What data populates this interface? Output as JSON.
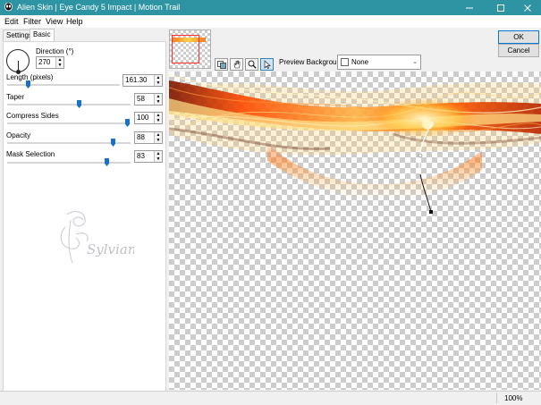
{
  "window": {
    "title": "Alien Skin | Eye Candy 5 Impact | Motion Trail",
    "controls": [
      "minimize-icon",
      "maximize-icon",
      "close-icon"
    ]
  },
  "menu": {
    "edit": "Edit",
    "filter": "Filter",
    "view": "View",
    "help": "Help"
  },
  "tabs": {
    "settings": "Settings",
    "basic": "Basic",
    "active": "Basic"
  },
  "basic": {
    "direction": {
      "label": "Direction (°)",
      "value": "270"
    },
    "length": {
      "label": "Length (pixels)",
      "value": "161.30",
      "slider": 0.18
    },
    "taper": {
      "label": "Taper",
      "value": "58",
      "slider": 0.58
    },
    "compress": {
      "label": "Compress Sides",
      "value": "100",
      "slider": 1.0
    },
    "opacity": {
      "label": "Opacity",
      "value": "88",
      "slider": 0.88
    },
    "mask": {
      "label": "Mask Selection",
      "value": "83",
      "slider": 0.83
    }
  },
  "watermark": {
    "text": "Sylviane"
  },
  "toolbar": {
    "tools": [
      "preview-toggle-icon",
      "hand-icon",
      "zoom-icon",
      "arrow-icon"
    ],
    "active_tool": "arrow-icon"
  },
  "preview_background": {
    "label": "Preview Background:",
    "value": "None"
  },
  "buttons": {
    "ok": "OK",
    "cancel": "Cancel"
  },
  "status": {
    "zoom": "100%"
  },
  "colors": {
    "titlebar": "#2e94a4",
    "accent": "#1872c8"
  }
}
